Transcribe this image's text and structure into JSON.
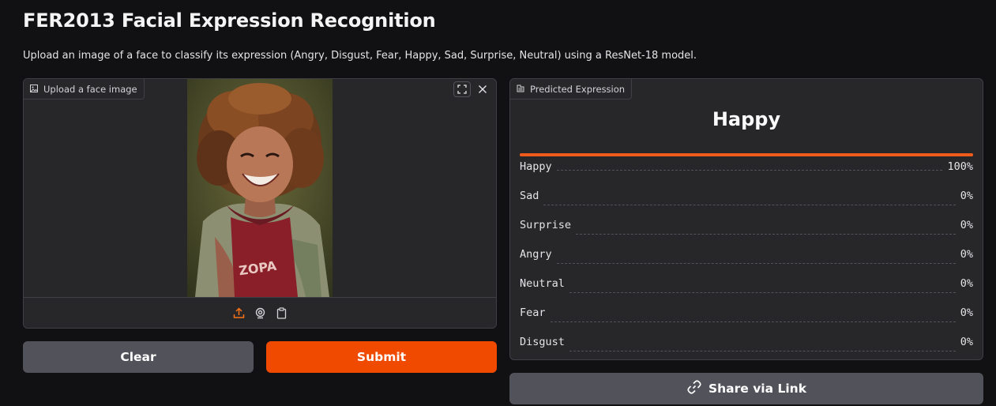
{
  "header": {
    "title": "FER2013 Facial Expression Recognition",
    "subtitle": "Upload an image of a face to classify its expression (Angry, Disgust, Fear, Happy, Sad, Surprise, Neutral) using a ResNet-18 model."
  },
  "input": {
    "label": "Upload a face image",
    "icons": [
      "image-icon",
      "fullscreen-icon",
      "close-icon",
      "upload-icon",
      "webcam-icon",
      "clipboard-icon"
    ]
  },
  "buttons": {
    "clear": "Clear",
    "submit": "Submit",
    "share": "Share via Link"
  },
  "output": {
    "label": "Predicted Expression",
    "prediction": "Happy",
    "top_confidence": 1.0,
    "confidences": [
      {
        "label": "Happy",
        "value": "100%"
      },
      {
        "label": "Sad",
        "value": "0%"
      },
      {
        "label": "Surprise",
        "value": "0%"
      },
      {
        "label": "Angry",
        "value": "0%"
      },
      {
        "label": "Neutral",
        "value": "0%"
      },
      {
        "label": "Fear",
        "value": "0%"
      },
      {
        "label": "Disgust",
        "value": "0%"
      }
    ]
  },
  "colors": {
    "accent": "#f04a00",
    "background": "#111113",
    "panel": "#27272a",
    "secondary_button": "#52525b"
  }
}
